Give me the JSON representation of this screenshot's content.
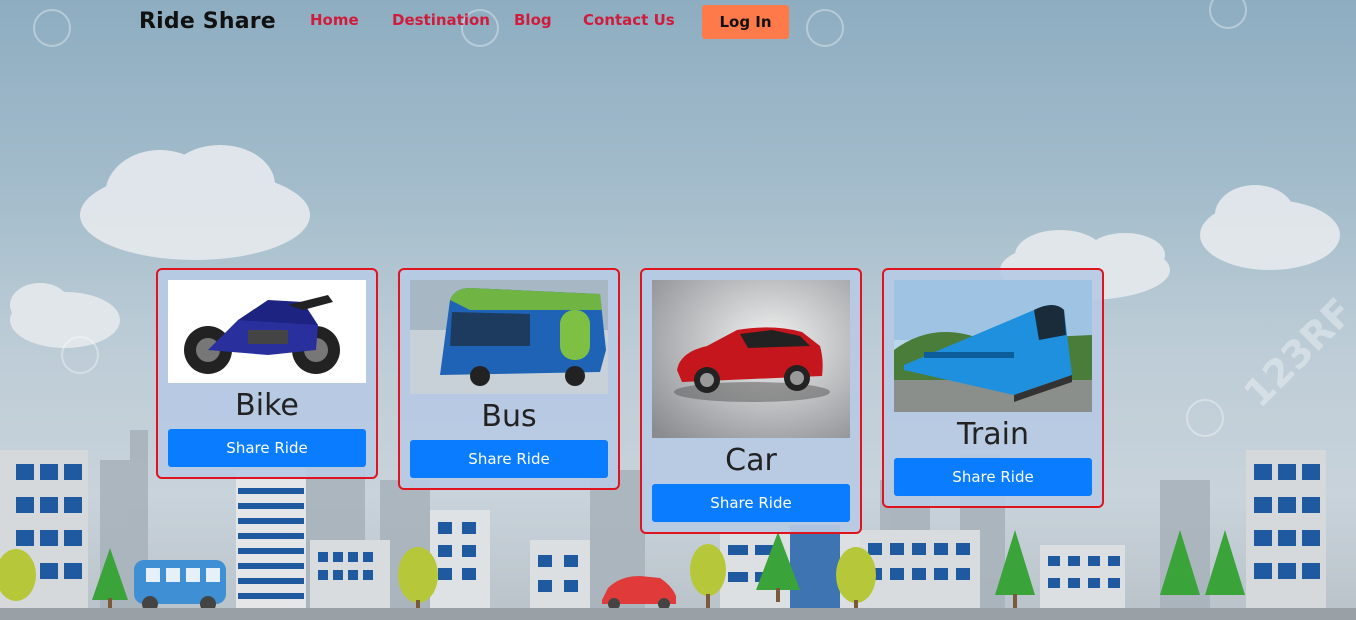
{
  "nav": {
    "brand": "Ride Share",
    "links": [
      "Home",
      "Destination",
      "Blog",
      "Contact Us"
    ],
    "login_label": "Log In"
  },
  "cards": [
    {
      "title": "Bike",
      "button": "Share Ride",
      "image": "motorcycle-image"
    },
    {
      "title": "Bus",
      "button": "Share Ride",
      "image": "bus-image"
    },
    {
      "title": "Car",
      "button": "Share Ride",
      "image": "car-image"
    },
    {
      "title": "Train",
      "button": "Share Ride",
      "image": "train-image"
    }
  ],
  "watermark": "123RF",
  "colors": {
    "nav_link": "#d01c3c",
    "login_bg": "#ff7a4a",
    "card_border": "#e0141e",
    "button_bg": "#0a7cff",
    "card_bg": "#b7cae4"
  }
}
